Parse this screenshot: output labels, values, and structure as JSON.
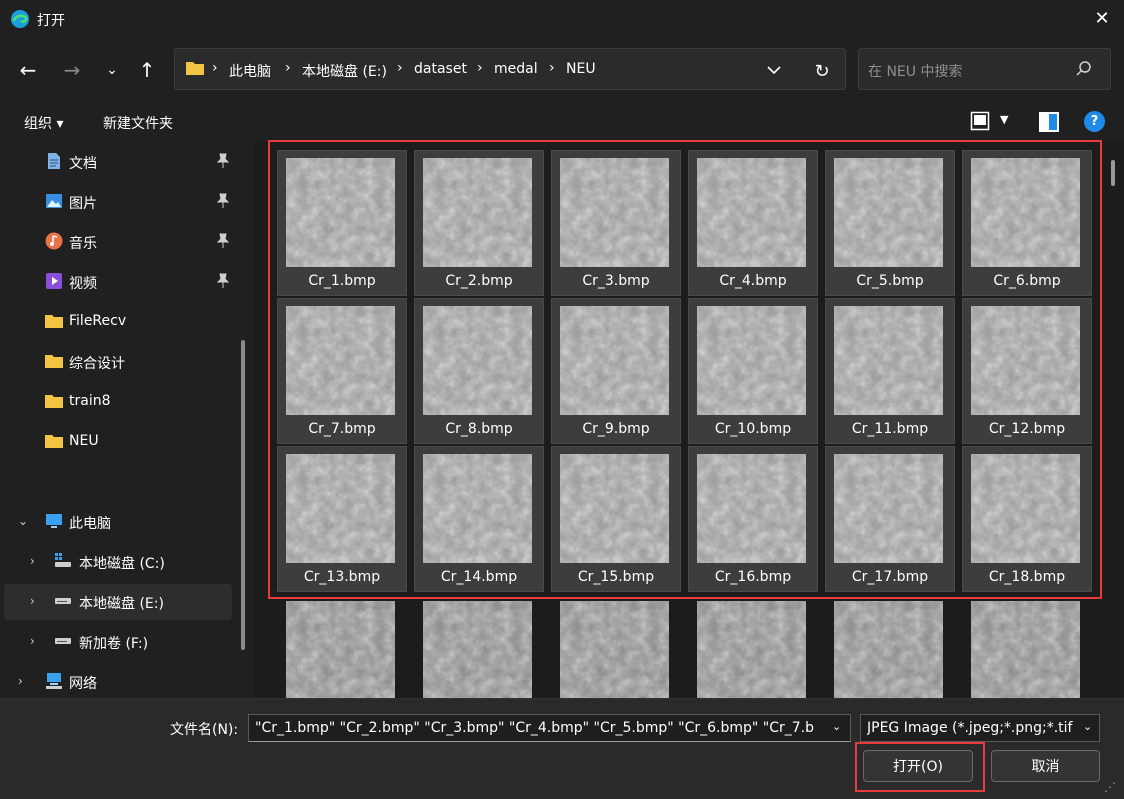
{
  "window": {
    "title": "打开",
    "close_label": "✕"
  },
  "nav": {
    "back": "←",
    "forward": "→",
    "recent": "⌄",
    "up": "↑",
    "refresh": "↻"
  },
  "address": {
    "crumbs": [
      "此电脑",
      "本地磁盘 (E:)",
      "dataset",
      "medal",
      "NEU"
    ],
    "separator": "›"
  },
  "search": {
    "placeholder": "在 NEU 中搜索"
  },
  "toolbar": {
    "organize": "组织 ▾",
    "new_folder": "新建文件夹",
    "help": "?"
  },
  "sidebar": {
    "quick": [
      {
        "label": "文档",
        "icon": "documents-icon",
        "pinned": true
      },
      {
        "label": "图片",
        "icon": "pictures-icon",
        "pinned": true
      },
      {
        "label": "音乐",
        "icon": "music-icon",
        "pinned": true
      },
      {
        "label": "视频",
        "icon": "videos-icon",
        "pinned": true
      },
      {
        "label": "FileRecv",
        "icon": "folder-icon",
        "pinned": false
      },
      {
        "label": "综合设计",
        "icon": "folder-icon",
        "pinned": false
      },
      {
        "label": "train8",
        "icon": "folder-icon",
        "pinned": false
      },
      {
        "label": "NEU",
        "icon": "folder-icon",
        "pinned": false
      }
    ],
    "this_pc": {
      "label": "此电脑",
      "icon": "computer-icon",
      "expanded": true
    },
    "drives": [
      {
        "label": "本地磁盘 (C:)",
        "icon": "windows-drive-icon",
        "selected": false
      },
      {
        "label": "本地磁盘 (E:)",
        "icon": "drive-icon",
        "selected": true
      },
      {
        "label": "新加卷 (F:)",
        "icon": "drive-icon",
        "selected": false
      }
    ],
    "network": {
      "label": "网络",
      "icon": "network-icon"
    }
  },
  "files": [
    "Cr_1.bmp",
    "Cr_2.bmp",
    "Cr_3.bmp",
    "Cr_4.bmp",
    "Cr_5.bmp",
    "Cr_6.bmp",
    "Cr_7.bmp",
    "Cr_8.bmp",
    "Cr_9.bmp",
    "Cr_10.bmp",
    "Cr_11.bmp",
    "Cr_12.bmp",
    "Cr_13.bmp",
    "Cr_14.bmp",
    "Cr_15.bmp",
    "Cr_16.bmp",
    "Cr_17.bmp",
    "Cr_18.bmp"
  ],
  "footer": {
    "filename_label": "文件名(N):",
    "filename_value": "\"Cr_1.bmp\" \"Cr_2.bmp\" \"Cr_3.bmp\" \"Cr_4.bmp\" \"Cr_5.bmp\" \"Cr_6.bmp\" \"Cr_7.b",
    "filetype_value": "JPEG Image (*.jpeg;*.png;*.tif",
    "open_label": "打开(O)",
    "cancel_label": "取消"
  },
  "colors": {
    "background": "#202020",
    "accent": "#1f8ae8",
    "highlight": "#e83a3a",
    "selected_tile": "#3d3d3d"
  }
}
